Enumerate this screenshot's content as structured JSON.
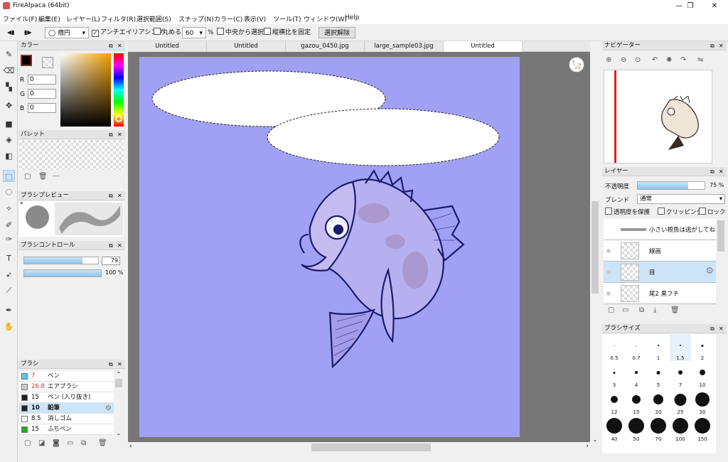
{
  "app": {
    "title": "FireAlpaca (64bit)"
  },
  "window_controls": {
    "minimize": "—",
    "maximize": "❐",
    "close": "✕"
  },
  "menu": [
    "ファイル(F)",
    "編集(E)",
    "レイヤー(L)",
    "フィルタ(R)",
    "選択範囲(S)",
    "スナップ(N)",
    "カラー(C)",
    "表示(V)",
    "ツール(T)",
    "ウィンドウ(W)",
    "Help"
  ],
  "toolbar": {
    "shape_value": "楕円",
    "antialias_label": "アンチエイリアシング",
    "antialias_checked": true,
    "round_label": "丸める",
    "round_value": "60",
    "round_unit": "%",
    "from_center_label": "中央から選択",
    "fix_ratio_label": "縦横比を固定",
    "deselect_label": "選択解除"
  },
  "tabs": [
    "Untitled",
    "Untitled",
    "gazou_0450.jpg",
    "large_sample03.jpg",
    "Untitled"
  ],
  "active_tab": 4,
  "color_panel": {
    "title": "カラー",
    "r_label": "R",
    "r_value": "0",
    "g_label": "G",
    "g_value": "0",
    "b_label": "B",
    "b_value": "0",
    "primary_color": "#000000",
    "secondary_color": "#ffffff"
  },
  "palette_panel": {
    "title": "パレット",
    "footer": "---"
  },
  "brush_preview_panel": {
    "title": "ブラシプレビュー",
    "marker": "*"
  },
  "brush_control_panel": {
    "title": "ブラシコントロール",
    "size_value": "79",
    "opacity_value": "100 %",
    "size_fraction": 0.79,
    "opacity_fraction": 1.0
  },
  "brush_panel": {
    "title": "ブラシ",
    "items": [
      {
        "size": "7",
        "name": "ペン",
        "color": "#57c8f0",
        "size_red": true
      },
      {
        "size": "26.8",
        "name": "エアブラシ",
        "color": "#cccccc",
        "size_red": true
      },
      {
        "size": "15",
        "name": "ペン (入り抜き)",
        "color": "#222222",
        "size_red": false
      },
      {
        "size": "10",
        "name": "鉛筆",
        "color": "#222222",
        "size_red": false,
        "selected": true
      },
      {
        "size": "8.5",
        "name": "消しゴム",
        "color": "#ffffff",
        "size_red": false
      },
      {
        "size": "15",
        "name": "ふちペン",
        "color": "#22aa22",
        "size_red": false
      }
    ]
  },
  "navigator_panel": {
    "title": "ナビゲーター"
  },
  "layer_panel": {
    "title": "レイヤー",
    "opacity_label": "不透明度",
    "opacity_value": "75 %",
    "opacity_fraction": 0.75,
    "blend_label": "ブレンド",
    "blend_value": "通常",
    "protect_alpha_label": "透明度を保護",
    "clipping_label": "クリッピング",
    "lock_label": "ロック",
    "layers": [
      {
        "name": "小さい根魚は逃がしてね"
      },
      {
        "name": "線画"
      },
      {
        "name": "目",
        "selected": true
      },
      {
        "name": "尾2 黒フチ"
      }
    ]
  },
  "brush_size_panel": {
    "title": "ブラシサイズ",
    "sizes": [
      "0.5",
      "0.7",
      "1",
      "1.5",
      "2",
      "3",
      "4",
      "5",
      "7",
      "10",
      "12",
      "15",
      "20",
      "25",
      "30",
      "40",
      "50",
      "70",
      "100",
      "150"
    ]
  },
  "colors": {
    "canvas_bg": "#a0a0f5",
    "selection_hl": "#cce4f7",
    "slider": "#9fd0f2"
  }
}
